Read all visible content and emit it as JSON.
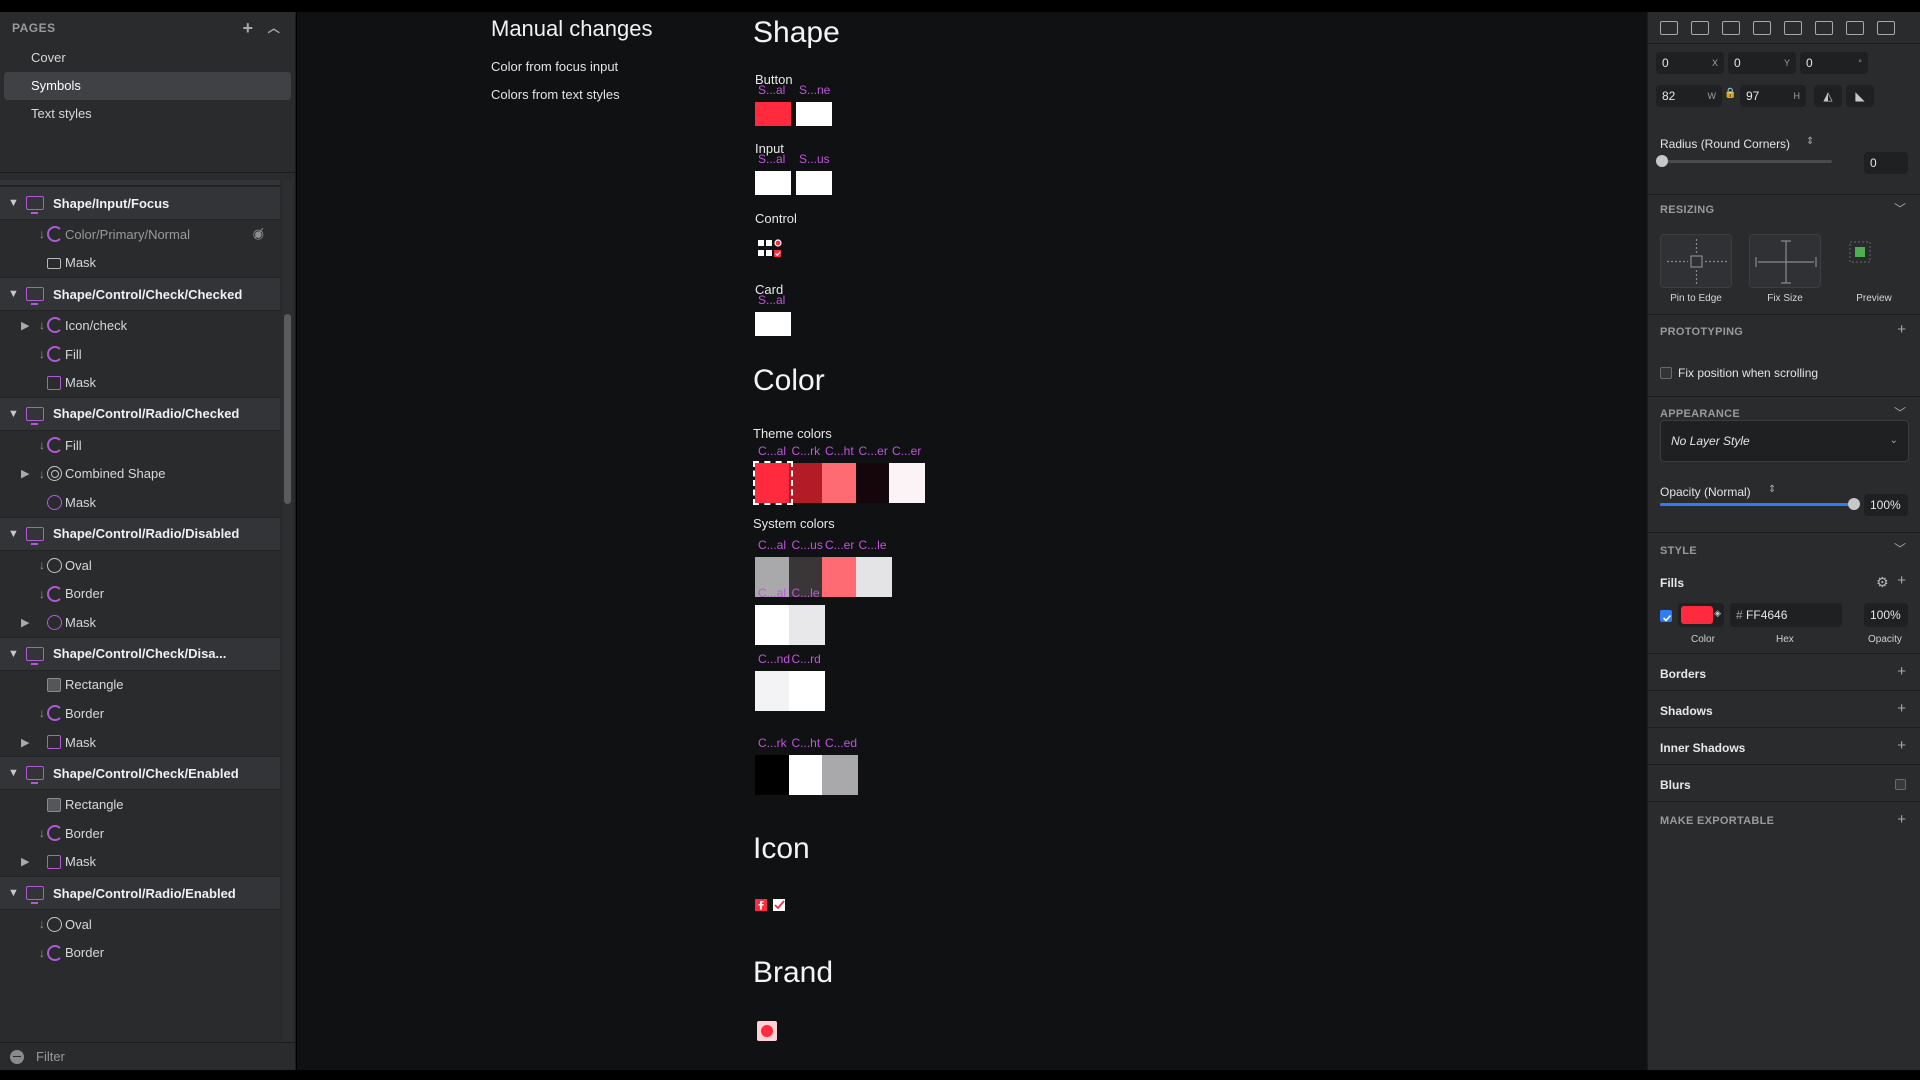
{
  "pages": {
    "header": "PAGES",
    "items": [
      {
        "label": "Cover",
        "selected": false
      },
      {
        "label": "Symbols",
        "selected": true
      },
      {
        "label": "Text styles",
        "selected": false
      }
    ]
  },
  "layers": {
    "groups": [
      {
        "title": "Shape/Input/Focus",
        "children": [
          {
            "label": "Color/Primary/Normal",
            "icon": "override",
            "dim": true,
            "hidden": true
          },
          {
            "label": "Mask",
            "icon": "rect"
          }
        ]
      },
      {
        "title": "Shape/Control/Check/Checked",
        "children": [
          {
            "label": "Icon/check",
            "icon": "override",
            "expand": true
          },
          {
            "label": "Fill",
            "icon": "override"
          },
          {
            "label": "Mask",
            "icon": "sq-purple"
          }
        ]
      },
      {
        "title": "Shape/Control/Radio/Checked",
        "children": [
          {
            "label": "Fill",
            "icon": "override"
          },
          {
            "label": "Combined Shape",
            "icon": "ring",
            "expand": true
          },
          {
            "label": "Mask",
            "icon": "circ-purple"
          }
        ]
      },
      {
        "title": "Shape/Control/Radio/Disabled",
        "children": [
          {
            "label": "Oval",
            "icon": "circ-grey"
          },
          {
            "label": "Border",
            "icon": "override"
          },
          {
            "label": "Mask",
            "icon": "circ-purple",
            "expand": true
          }
        ]
      },
      {
        "title": "Shape/Control/Check/Disa...",
        "children": [
          {
            "label": "Rectangle",
            "icon": "greybox"
          },
          {
            "label": "Border",
            "icon": "override"
          },
          {
            "label": "Mask",
            "icon": "sq-purple",
            "expand": true
          }
        ]
      },
      {
        "title": "Shape/Control/Check/Enabled",
        "children": [
          {
            "label": "Rectangle",
            "icon": "greybox"
          },
          {
            "label": "Border",
            "icon": "override"
          },
          {
            "label": "Mask",
            "icon": "sq-purple",
            "expand": true
          }
        ]
      },
      {
        "title": "Shape/Control/Radio/Enabled",
        "children": [
          {
            "label": "Oval",
            "icon": "circ-grey"
          },
          {
            "label": "Border",
            "icon": "override"
          }
        ]
      }
    ],
    "filter_placeholder": "Filter"
  },
  "canvas": {
    "manual": {
      "title": "Manual changes",
      "lines": [
        "Color from focus input",
        "Colors from text styles"
      ]
    },
    "shape": {
      "title": "Shape",
      "button": {
        "label": "Button",
        "tags": [
          "S...al",
          "S...ne"
        ],
        "colors": [
          "#ff2a3d",
          "#ffffff"
        ]
      },
      "input": {
        "label": "Input",
        "tags": [
          "S...al",
          "S...us"
        ],
        "colors": [
          "#ffffff",
          "#ffffff"
        ]
      },
      "control": {
        "label": "Control"
      },
      "card": {
        "label": "Card",
        "tags": [
          "S...al"
        ],
        "colors": [
          "#ffffff"
        ]
      }
    },
    "color": {
      "title": "Color",
      "theme": {
        "label": "Theme colors",
        "tags": [
          "C...al",
          "C...rk",
          "C...ht",
          "C...er",
          "C...er"
        ],
        "colors": [
          "#ff2a3d",
          "#b31b26",
          "#ff6b72",
          "#14060a",
          "#fbf3f5"
        ]
      },
      "system": {
        "label": "System colors",
        "row1": {
          "tags": [
            "C...al",
            "C...us",
            "C...er",
            "C...le"
          ],
          "colors": [
            "#a9a9ab",
            "#3a3536",
            "#ff6b72",
            "#e4e4e6"
          ]
        },
        "row2": {
          "tags": [
            "C...al",
            "C...le"
          ],
          "colors": [
            "#ffffff",
            "#e8e8ea"
          ]
        },
        "row3": {
          "tags": [
            "C...nd",
            "C...rd"
          ],
          "colors": [
            "#f3f3f5",
            "#ffffff"
          ]
        },
        "row4": {
          "tags": [
            "C...rk",
            "C...ht",
            "C...ed"
          ],
          "colors": [
            "#000000",
            "#ffffff",
            "#a9a9ab"
          ]
        }
      }
    },
    "icon": {
      "title": "Icon"
    },
    "brand": {
      "title": "Brand"
    }
  },
  "inspector": {
    "x": "0",
    "x_label": "X",
    "y": "0",
    "y_label": "Y",
    "rotation": "0",
    "rotation_label": "°",
    "w": "82",
    "w_label": "W",
    "h": "97",
    "h_label": "H",
    "radius_label": "Radius (Round Corners)",
    "radius_value": "0",
    "resizing": {
      "title": "RESIZING",
      "options": [
        "Pin to Edge",
        "Fix Size",
        "Preview"
      ]
    },
    "prototyping": {
      "title": "PROTOTYPING",
      "fix_position": "Fix position when scrolling",
      "fix_checked": false
    },
    "appearance": {
      "title": "APPEARANCE",
      "layer_style": "No Layer Style",
      "opacity_label": "Opacity (Normal)",
      "opacity_value": "100%",
      "opacity_fraction": 1.0
    },
    "style": {
      "title": "STYLE",
      "fills_label": "Fills",
      "fill": {
        "enabled": true,
        "color": "#ff2a3d",
        "hex": "FF4646",
        "hex_prefix": "#",
        "opacity": "100%"
      },
      "captions": [
        "Color",
        "Hex",
        "Opacity"
      ],
      "borders": "Borders",
      "shadows": "Shadows",
      "inner_shadows": "Inner Shadows",
      "blurs": "Blurs"
    },
    "exportable": "MAKE EXPORTABLE"
  },
  "colors": {
    "accent_purple": "#c154e0",
    "brand_red": "#ff2a3d",
    "focus_blue": "#2f7cf6"
  }
}
